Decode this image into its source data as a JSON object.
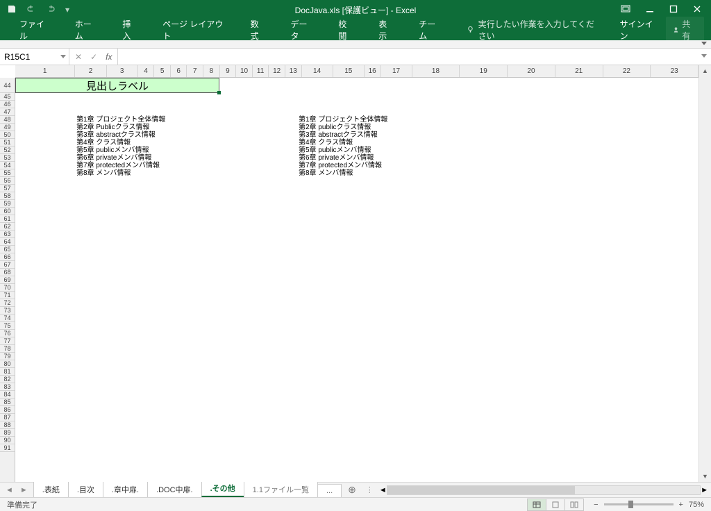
{
  "titlebar": {
    "title": "DocJava.xls  [保護ビュー] - Excel"
  },
  "ribbon": {
    "tabs": [
      "ファイル",
      "ホーム",
      "挿入",
      "ページ レイアウト",
      "数式",
      "データ",
      "校閲",
      "表示",
      "チーム"
    ],
    "tell_me": "実行したい作業を入力してください",
    "signin": "サインイン",
    "share": "共有"
  },
  "formula": {
    "name_box": "R15C1",
    "fx_label": "fx",
    "value": ""
  },
  "grid": {
    "col_headers": [
      "1",
      "2",
      "3",
      "4",
      "5",
      "6",
      "7",
      "8",
      "9",
      "10",
      "11",
      "12",
      "13",
      "14",
      "15",
      "16",
      "17",
      "18",
      "19",
      "20",
      "21",
      "22",
      "23"
    ],
    "first_row": 44,
    "heading_label": "見出しラベル",
    "chapters_left": [
      "第1章  プロジェクト全体情報",
      "第2章  Publicクラス情報",
      "第3章  abstractクラス情報",
      "第4章  クラス情報",
      "第5章  publicメンバ情報",
      "第6章  privateメンバ情報",
      "第7章  protectedメンバ情報",
      "第8章  メンバ情報"
    ],
    "chapters_right": [
      "第1章  プロジェクト全体情報",
      "第2章  publicクラス情報",
      "第3章  abstractクラス情報",
      "第4章  クラス情報",
      "第5章  publicメンバ情報",
      "第6章  privateメンバ情報",
      "第7章  protectedメンバ情報",
      "第8章  メンバ情報"
    ]
  },
  "sheets": {
    "tabs": [
      ".表紙",
      ".目次",
      ".章中扉.",
      ".DOC中扉.",
      ".その他",
      "1.1ファイル一覧",
      "..."
    ],
    "active_index": 4
  },
  "status": {
    "ready": "準備完了",
    "zoom": "75%"
  }
}
